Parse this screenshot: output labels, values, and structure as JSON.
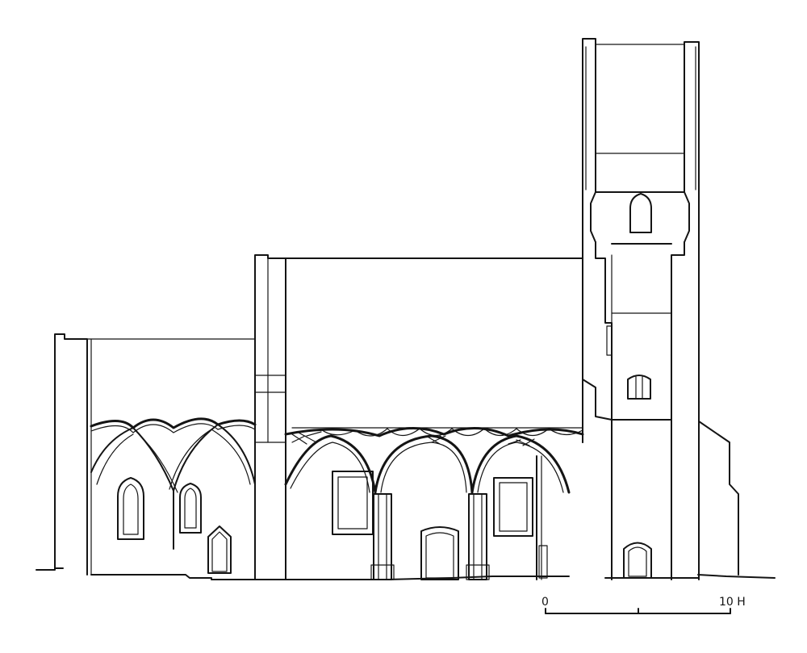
{
  "scale_bar": {
    "start_label": "0",
    "end_label": "10 H"
  }
}
